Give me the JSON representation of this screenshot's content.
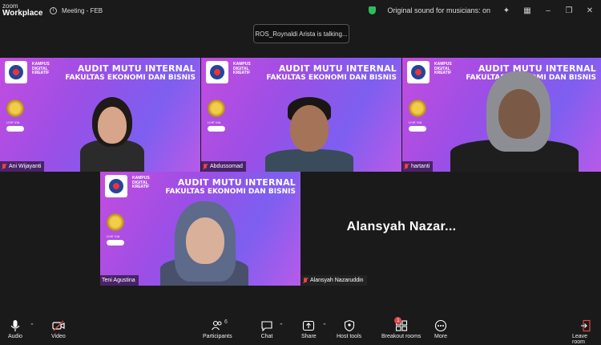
{
  "titlebar": {
    "brand_top": "zoom",
    "brand_bottom": "Workplace",
    "meeting_title": "Meeting - FEB",
    "original_sound": "Original sound for musicians: on"
  },
  "talking_indicator": "ROS_Roynaldi Arista is talking...",
  "banner": {
    "kampus": [
      "KAMPUS",
      "DIGITAL",
      "KREATIF"
    ],
    "line1": "AUDIT MUTU INTERNAL",
    "line2": "FAKULTAS EKONOMI DAN BISNIS",
    "live_via": "LIVE VIA",
    "zoom_tag": "zoom"
  },
  "participants": [
    {
      "name": "Ani Wijayanti",
      "muted": true
    },
    {
      "name": "Abdussomad",
      "muted": true
    },
    {
      "name": "hartanti",
      "muted": true
    },
    {
      "name": "Teni Agustina",
      "muted": false
    },
    {
      "name": "Alansyah Nazaruddin",
      "muted": true,
      "video_off": true,
      "display_name": "Alansyah  Nazar..."
    }
  ],
  "toolbar": {
    "audio": "Audio",
    "video": "Video",
    "participants": "Participants",
    "participants_count": "6",
    "chat": "Chat",
    "share": "Share",
    "host_tools": "Host tools",
    "breakout_rooms": "Breakout rooms",
    "breakout_badge": "1",
    "more": "More",
    "leave_room": "Leave room"
  },
  "colors": {
    "mute_red": "#e64545",
    "secure_green": "#2ebd59",
    "banner_purple": "#9a4fe6"
  }
}
